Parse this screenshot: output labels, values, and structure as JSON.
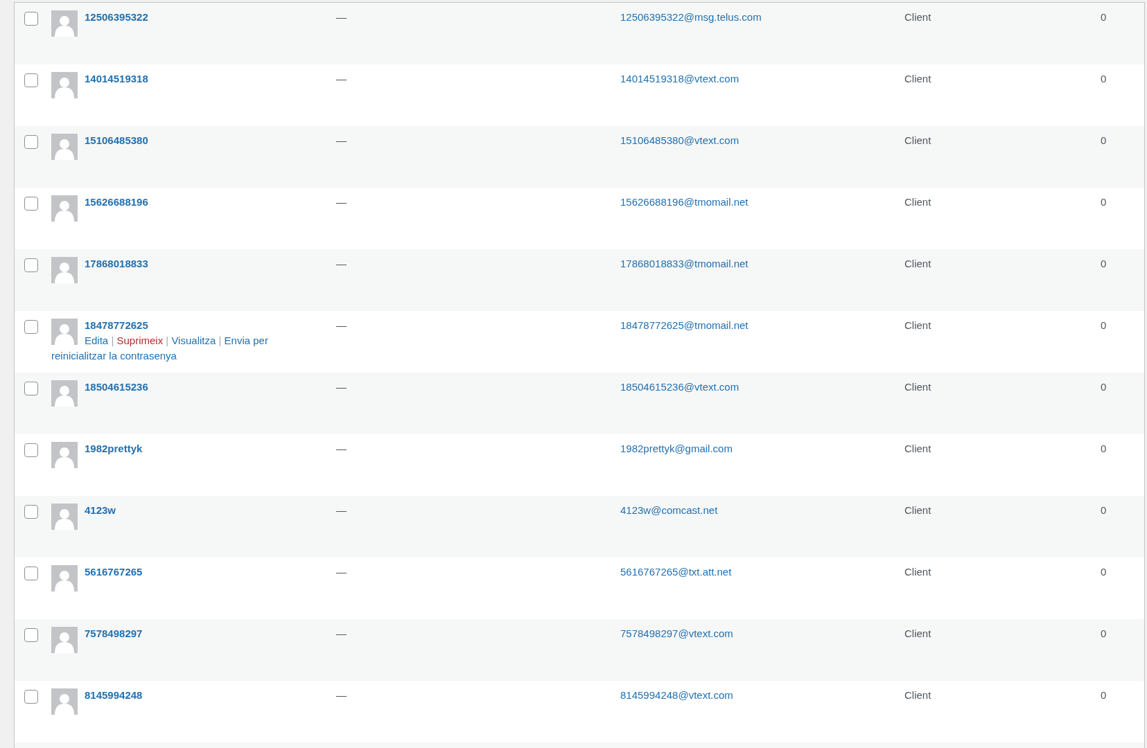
{
  "users": [
    {
      "username": "12506395322",
      "name": "—",
      "email": "12506395322@msg.telus.com",
      "role": "Client",
      "posts": "0",
      "checked": false
    },
    {
      "username": "14014519318",
      "name": "—",
      "email": "14014519318@vtext.com",
      "role": "Client",
      "posts": "0",
      "checked": false
    },
    {
      "username": "15106485380",
      "name": "—",
      "email": "15106485380@vtext.com",
      "role": "Client",
      "posts": "0",
      "checked": false
    },
    {
      "username": "15626688196",
      "name": "—",
      "email": "15626688196@tmomail.net",
      "role": "Client",
      "posts": "0",
      "checked": false
    },
    {
      "username": "17868018833",
      "name": "—",
      "email": "17868018833@tmomail.net",
      "role": "Client",
      "posts": "0",
      "checked": false
    },
    {
      "username": "18478772625",
      "name": "—",
      "email": "18478772625@tmomail.net",
      "role": "Client",
      "posts": "0",
      "checked": false,
      "separator": "|",
      "actions": [
        {
          "label": "Edita",
          "kind": "link"
        },
        {
          "label": "Suprimeix",
          "kind": "delete"
        },
        {
          "label": "Visualitza",
          "kind": "link"
        },
        {
          "label": "Envia per reinicialitzar la contrasenya",
          "kind": "link"
        }
      ]
    },
    {
      "username": "18504615236",
      "name": "—",
      "email": "18504615236@vtext.com",
      "role": "Client",
      "posts": "0",
      "checked": false
    },
    {
      "username": "1982prettyk",
      "name": "—",
      "email": "1982prettyk@gmail.com",
      "role": "Client",
      "posts": "0",
      "checked": false
    },
    {
      "username": "4123w",
      "name": "—",
      "email": "4123w@comcast.net",
      "role": "Client",
      "posts": "0",
      "checked": false
    },
    {
      "username": "5616767265",
      "name": "—",
      "email": "5616767265@txt.att.net",
      "role": "Client",
      "posts": "0",
      "checked": false
    },
    {
      "username": "7578498297",
      "name": "—",
      "email": "7578498297@vtext.com",
      "role": "Client",
      "posts": "0",
      "checked": false
    },
    {
      "username": "8145994248",
      "name": "—",
      "email": "8145994248@vtext.com",
      "role": "Client",
      "posts": "0",
      "checked": false
    }
  ]
}
